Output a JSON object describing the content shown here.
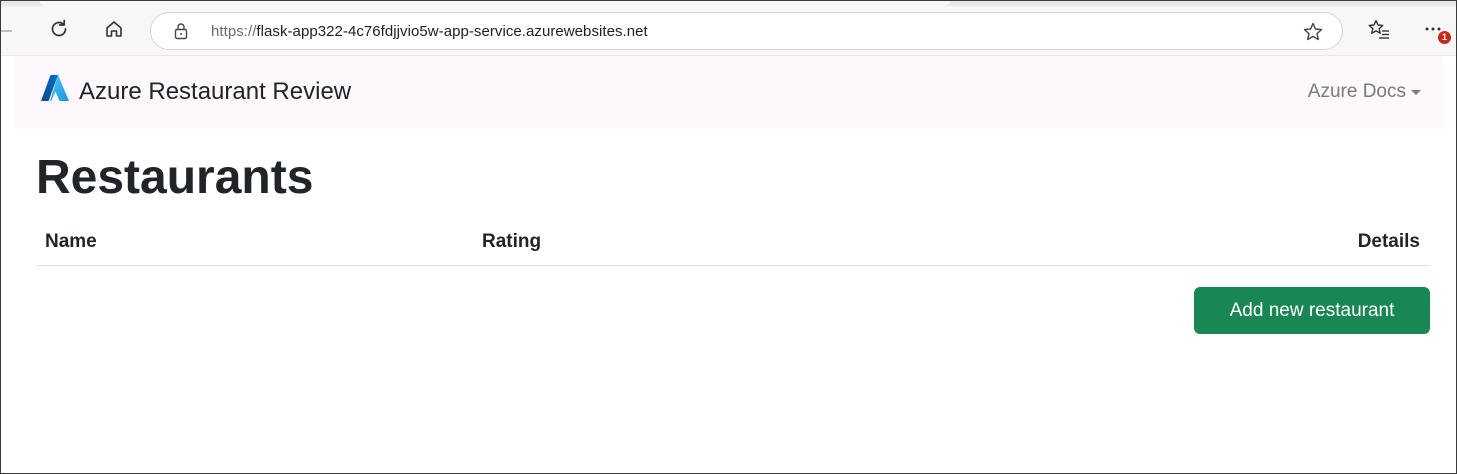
{
  "browser": {
    "url_protocol": "https://",
    "url_host": "flask-app322-4c76fdjjvio5w-app-service.azurewebsites.net",
    "notification_count": "1",
    "icons": [
      "refresh-icon",
      "home-icon",
      "lock-icon",
      "favorite-star-icon",
      "favorites-list-icon",
      "more-menu-icon"
    ]
  },
  "navbar": {
    "brand_title": "Azure Restaurant Review",
    "dropdown_label": "Azure Docs",
    "logo_icon": "azure-logo-icon"
  },
  "main": {
    "page_title": "Restaurants",
    "table": {
      "columns": [
        "Name",
        "Rating",
        "Details"
      ],
      "rows": []
    },
    "add_button_label": "Add new restaurant"
  },
  "colors": {
    "navbar_bg": "#fcf8fc",
    "primary_button": "#198754",
    "azure_blue": "#0078d4"
  }
}
